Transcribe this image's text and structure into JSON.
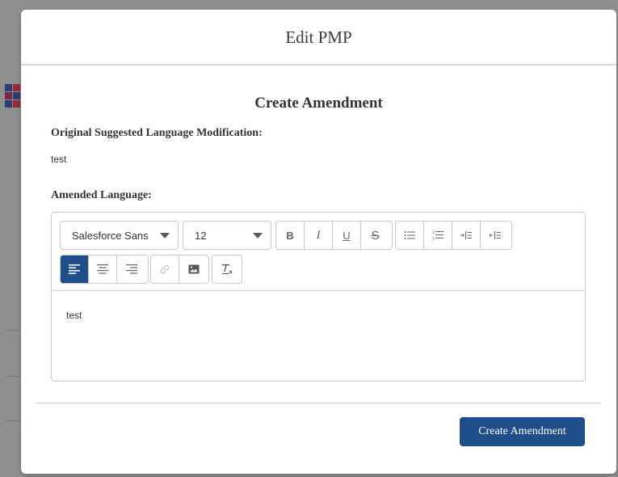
{
  "modal": {
    "title": "Edit PMP",
    "section_title": "Create Amendment",
    "original_label": "Original Suggested Language Modification:",
    "original_value": "test",
    "amended_label": "Amended Language:",
    "editor": {
      "font_family_value": "Salesforce Sans",
      "font_size_value": "12",
      "content": "test",
      "toolbar_icons": [
        "bold-icon",
        "italic-icon",
        "underline-icon",
        "strikethrough-icon",
        "bullet-list-icon",
        "numbered-list-icon",
        "indent-icon",
        "outdent-icon",
        "align-left-icon",
        "align-center-icon",
        "align-right-icon",
        "link-icon",
        "image-icon",
        "clear-format-icon"
      ]
    },
    "submit_label": "Create Amendment"
  },
  "colors": {
    "primary": "#1f4e8c",
    "border": "#c9c9c9"
  }
}
